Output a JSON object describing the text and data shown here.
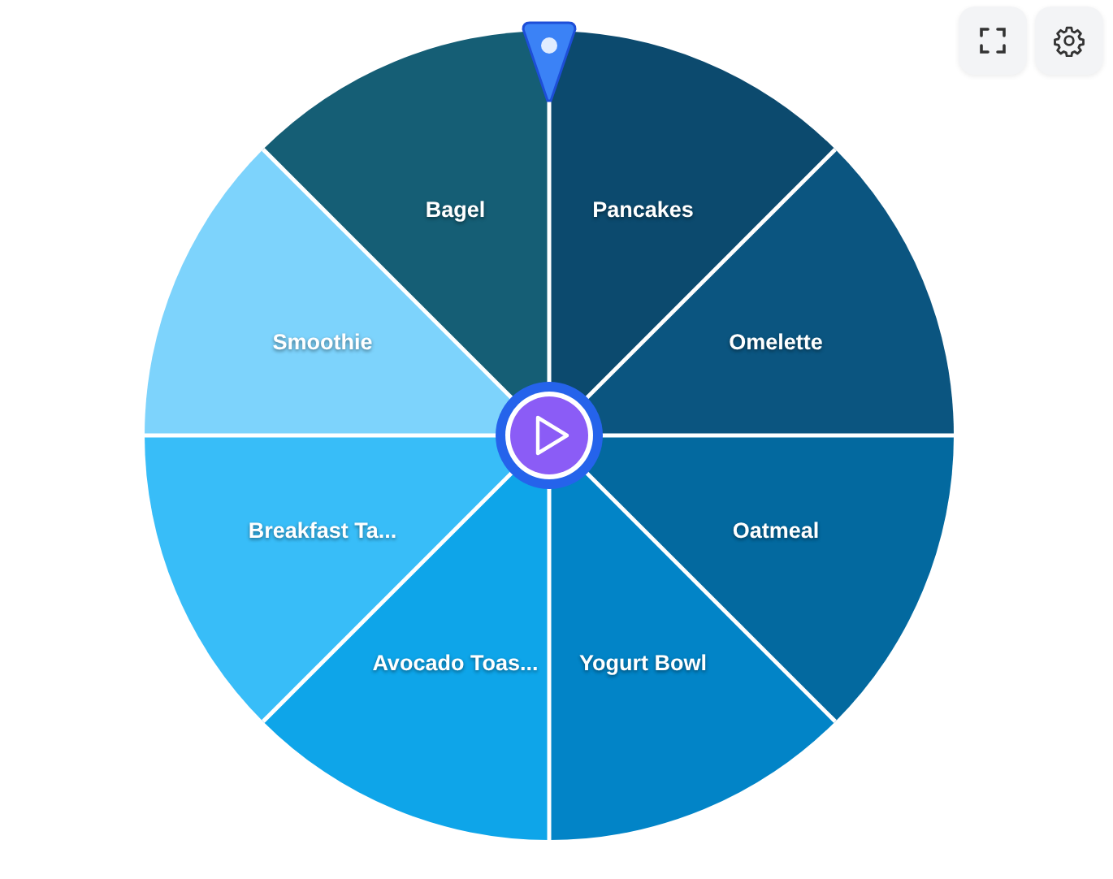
{
  "wheel": {
    "segments": [
      {
        "label": "Pancakes",
        "color": "#0c4a6e"
      },
      {
        "label": "Omelette",
        "color": "#0b5580"
      },
      {
        "label": "Oatmeal",
        "color": "#03699f"
      },
      {
        "label": "Yogurt Bowl",
        "color": "#0284c7"
      },
      {
        "label": "Avocado Toas...",
        "color": "#0ea5e9"
      },
      {
        "label": "Breakfast Ta...",
        "color": "#38bdf8"
      },
      {
        "label": "Smoothie",
        "color": "#7dd3fc"
      },
      {
        "label": "Bagel",
        "color": "#155e75"
      }
    ]
  }
}
